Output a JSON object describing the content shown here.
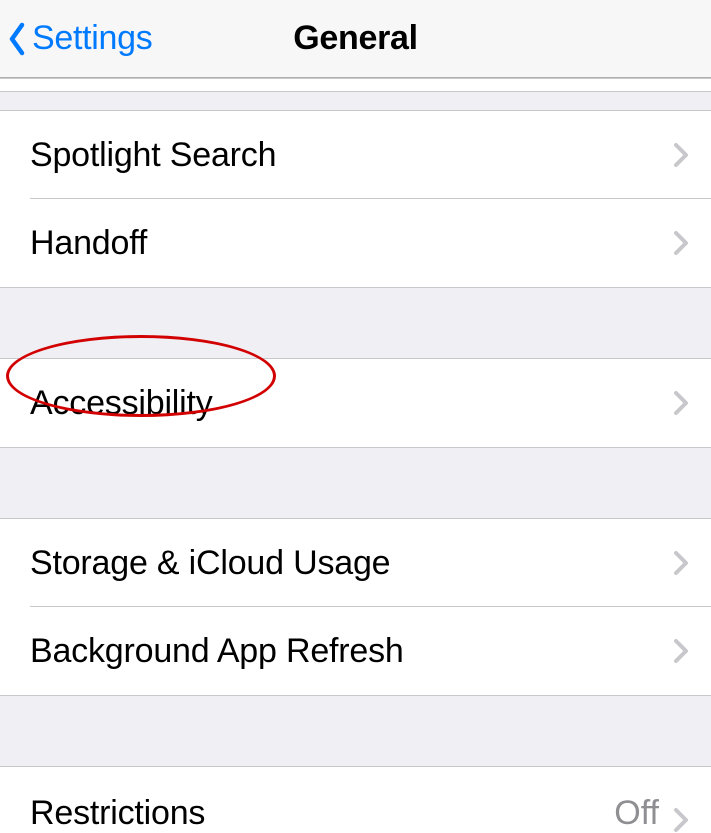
{
  "nav": {
    "back_label": "Settings",
    "title": "General"
  },
  "rows": {
    "spotlight": "Spotlight Search",
    "handoff": "Handoff",
    "accessibility": "Accessibility",
    "storage": "Storage & iCloud Usage",
    "background_refresh": "Background App Refresh",
    "restrictions": "Restrictions",
    "restrictions_value": "Off"
  }
}
